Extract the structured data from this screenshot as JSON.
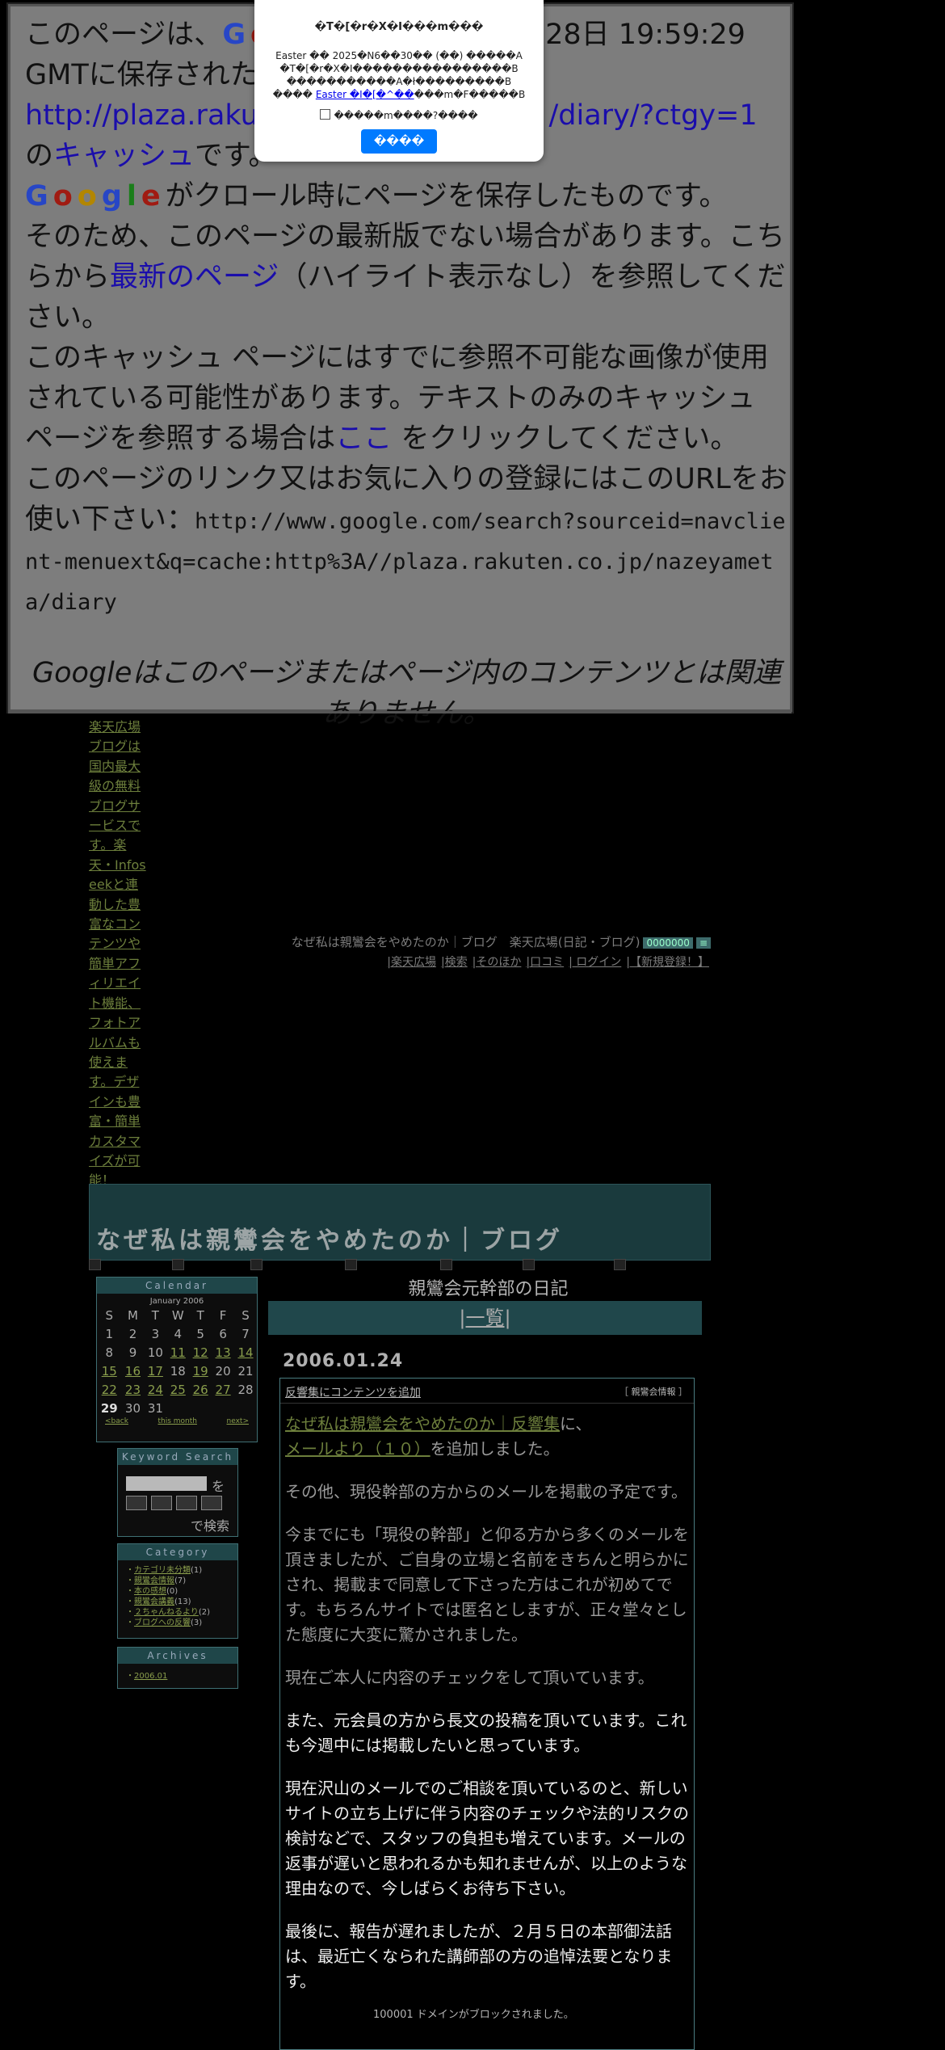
{
  "cache_notice": {
    "line1_pre": "このページは、",
    "line1_post": "月28日 19:59:29",
    "line2": "GMTに保存された",
    "url": "http://plaza.rakuten.co.jp/nazeyameta/diary/?ctgy=1",
    "url_visible_start": "http://plaza.rakut",
    "url_visible_end": "/diary/?ctgy=1",
    "no": "の",
    "cache_link": "キャッシュ",
    "desu": "です。",
    "google_letters": [
      "G",
      "o",
      "o",
      "g",
      "l",
      "e"
    ],
    "para2_a": "がクロール時にページを保存したものです。",
    "para2_b": "そのため、このページの最新版でない場合があります。こちらから",
    "latest_link": "最新のページ",
    "para2_c": "（ハイライト表示なし）を参照してください。",
    "para3_a": "このキャッシュ ページにはすでに参照不可能な画像が使用されている可能性があります。テキストのみのキャッシュ ページを参照する場合は",
    "here_link": "ここ",
    "para3_b": " をクリックしてください。",
    "para4": "このページのリンク又はお気に入りの登録にはこのURLをお使い下さい：",
    "cache_url": "http://www.google.com/search?sourceid=navclient-menuext&q=cache:http%3A//plaza.rakuten.co.jp/nazeyameta/diary",
    "disclaimer": "Googleはこのページまたはページ内のコンテンツとは関連ありません。"
  },
  "modal": {
    "title": "�T�[�r�X�I���m���",
    "body_1": "Easter �� 2025�N6��30�� (��) �����A",
    "body_2": "�T�[�r�X�I����������������B",
    "body_3": "�����������A�ł���������B",
    "body_4_pre": "���� ",
    "body_4_link": "Easter �I�[�^��",
    "body_4_post": "���m�F�����B",
    "checkbox_label": "�����m����?����",
    "button_label": "����"
  },
  "ad": {
    "text": "楽天広場ブログは国内最大級の無料ブログサービスです。楽天・Infoseekと連動した豊富なコンテンツや簡単アフィリエイト機能、フォトアルバムも使えます。デザインも豊富・簡単カスタマイズが可能！"
  },
  "header": {
    "title_line": "なぜ私は親鸞会をやめたのか｜ブログ　楽天広場(日記・ブログ)",
    "badge": "0000000",
    "nav": [
      "|楽天広場",
      "|検索",
      "|そのほか",
      "|口コミ",
      "| ログイン",
      "|【新規登録！】"
    ]
  },
  "banner": {
    "title": "なぜ私は親鸞会をやめたのか｜ブログ"
  },
  "main": {
    "diary_title": "親鸞会元幹部の日記",
    "list_label": "一覧",
    "date": "2006.01.24",
    "entry_title": "反響集にコンテンツを追加",
    "entry_category": "［ 親鸞会情報 ］",
    "p1_link1": "なぜ私は親鸞会をやめたのか｜反響集",
    "p1_mid": "に、",
    "p1_link2": "メールより（１０）",
    "p1_post": "を追加しました。",
    "p2": "その他、現役幹部の方からのメールを掲載の予定です。",
    "p3": "今までにも「現役の幹部」と仰る方から多くのメールを頂きましたが、ご自身の立場と名前をきちんと明らかにされ、掲載まで同意して下さった方はこれが初めてです。もちろんサイトでは匿名としますが、正々堂々とした態度に大変に驚かされました。",
    "p4": "現在ご本人に内容のチェックをして頂いています。",
    "p5": "また、元会員の方から長文の投稿を頂いています。これも今週中には掲載したいと思っています。",
    "p6": "現在沢山のメールでのご相談を頂いているのと、新しいサイトの立ち上げに伴う内容のチェックや法的リスクの検討などで、スタッフの負担も増えています。メールの返事が遅いと思われるかも知れませんが、以上のような理由なので、今しばらくお待ち下さい。",
    "p7": "最後に、報告が遅れましたが、２月５日の本部御法話は、最近亡くなられた講師部の方の追悼法要となります。"
  },
  "calendar": {
    "header": "Calendar",
    "month": "January 2006",
    "weekdays": [
      "S",
      "M",
      "T",
      "W",
      "T",
      "F",
      "S"
    ],
    "weeks": [
      [
        "1",
        "2",
        "3",
        "4",
        "5",
        "6",
        "7"
      ],
      [
        "8",
        "9",
        "10",
        "11",
        "12",
        "13",
        "14"
      ],
      [
        "15",
        "16",
        "17",
        "18",
        "19",
        "20",
        "21"
      ],
      [
        "22",
        "23",
        "24",
        "25",
        "26",
        "27",
        "28"
      ],
      [
        "29",
        "30",
        "31",
        "",
        "",
        "",
        ""
      ]
    ],
    "linked_days": [
      "11",
      "12",
      "13",
      "14",
      "15",
      "16",
      "17",
      "19",
      "22",
      "23",
      "24",
      "25",
      "26",
      "27"
    ],
    "nav": [
      "<back",
      "this month",
      "next>"
    ]
  },
  "keyword_search": {
    "header": "Keyword Search",
    "wo": "を",
    "search_label": "で検索"
  },
  "category": {
    "header": "Category",
    "items": [
      {
        "label": "カテゴリ未分類",
        "count": "(1)"
      },
      {
        "label": "親鸞会情報",
        "count": "(7)"
      },
      {
        "label": "本の感想",
        "count": "(0)"
      },
      {
        "label": "親鸞会講義",
        "count": "(13)"
      },
      {
        "label": "２ちゃんねるより",
        "count": "(2)"
      },
      {
        "label": "ブログへの反響",
        "count": "(3)"
      }
    ]
  },
  "archives": {
    "header": "Archives",
    "items": [
      "2006.01"
    ]
  },
  "blocked_notice": "100001 ドメインがブロックされました。",
  "colors": {
    "cache_bg": "#7d7d7d",
    "link_blue": "#1a0dab",
    "blog_accent": "#1f4649",
    "blog_link": "#6d7f3c",
    "modal_button": "#007aff"
  }
}
